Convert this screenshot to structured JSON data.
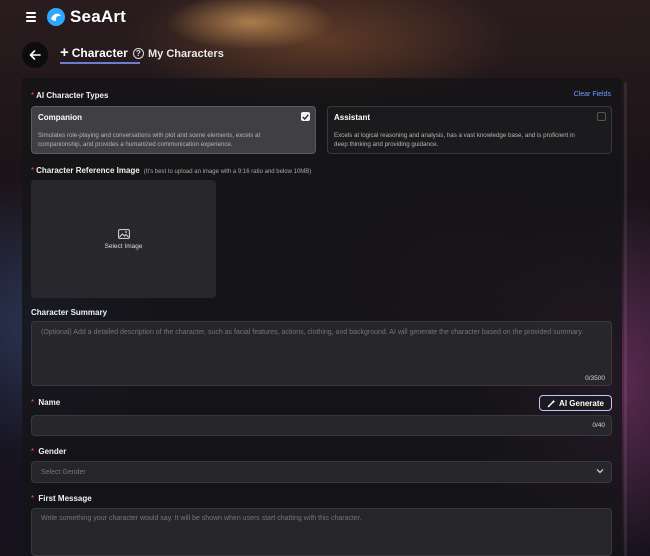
{
  "app": {
    "name": "SeaArt"
  },
  "tabs": {
    "create_label": "Character",
    "mine_label": "My Characters"
  },
  "form": {
    "types": {
      "label": "AI Character Types",
      "clear_label": "Clear Fields",
      "options": [
        {
          "title": "Companion",
          "desc": "Simulates role-playing and conversations with plot and scene elements, excels at companionship, and provides a humanized communication experience.",
          "selected": true
        },
        {
          "title": "Assistant",
          "desc": "Excels at logical reasoning and analysis, has a vast knowledge base, and is proficient in deep thinking and providing guidance.",
          "selected": false
        }
      ]
    },
    "reference": {
      "label": "Character Reference Image",
      "hint": "(It's best to upload an image with a 9:16 ratio and below 10MB)",
      "select_label": "Select Image"
    },
    "summary": {
      "label": "Character Summary",
      "placeholder": "(Optional) Add a detailed description of the character, such as facial features, actions, clothing, and background. AI will generate the character based on the provided summary.",
      "counter": "0/3500"
    },
    "name": {
      "label": "Name",
      "ai_button": "AI Generate",
      "counter": "0/40"
    },
    "gender": {
      "label": "Gender",
      "placeholder": "Select Gender"
    },
    "first_message": {
      "label": "First Message",
      "placeholder": "Write something your character would say. It will be shown when users start chatting with this character."
    }
  },
  "colors": {
    "accent": "#6c7ccf",
    "required": "#ff4b4b",
    "link": "#6aa0ff",
    "logo": "#2fa8ff"
  },
  "icons": [
    "menu-icon",
    "seaart-logo-icon",
    "back-arrow-icon",
    "plus-icon",
    "help-icon",
    "check-icon",
    "image-icon",
    "magic-wand-icon",
    "chevron-down-icon"
  ]
}
